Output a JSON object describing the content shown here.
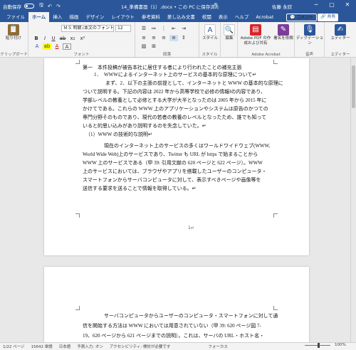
{
  "titlebar": {
    "autosave": "自動保存",
    "doc_title": "14_準備書面（1）.docx • この PC に保存済み",
    "search_label": "🔍",
    "user": "佐藤 永欣",
    "minimize": "─",
    "restore": "▢",
    "close": "✕"
  },
  "tabs": [
    "ファイル",
    "ホーム",
    "挿入",
    "描画",
    "デザイン",
    "レイアウト",
    "参考資料",
    "差し込み文書",
    "校閲",
    "表示",
    "ヘルプ",
    "Acrobat"
  ],
  "tabs_active_index": 1,
  "ribbon": {
    "comment_btn": "💬 コメント",
    "share_btn": "🔗 共有",
    "paste": "貼り付け",
    "clipboard": "クリップボード",
    "font_name": "ＭＳ 明朝 (本文のフォント - 日本語)",
    "font_size": "12",
    "font_group": "フォント",
    "paragraph_group": "段落",
    "style": "スタイル",
    "styles_group": "スタイル",
    "edit": "編集",
    "adobe_pdf": "Adobe PDF の作成および共有",
    "sign": "署名を依頼",
    "acrobat_group": "Adobe Acrobat",
    "dictate": "ディクテーション",
    "voice_group": "音声",
    "editor": "エディター",
    "editor_group": "エディター"
  },
  "document": {
    "page1_lines": [
      "第一　本件投稿が被告本社に居住する者により行われたことの補充主張",
      "1．　WWWによるインターネット上のサービスの基本的な原理について↵",
      "まず、2．以下の主張の前提として、インターネットと WWW の基本的な原理に",
      "ついて説明する。下記の内容は 2022 年から高等学校で必修の情報Ⅰの内容であり、",
      "学部レベルの教養として必修とする大学が大半となったのは 2005 年から 2015 年に",
      "かけてである。これらの WWW 上のアプリケーションやシステムは原告のかつての",
      "専門分野そのものであり、現代の若者の教養のレベルとなったため、誰でも知って",
      "いると的思い込みがあり説明するのを失念していた。↵",
      "（1）WWW の技術的な説明↵",
      "現在のインターネット上のサービスの多くはワールドワイドウェブ(WWW,",
      "World Wide Web)上のサービスであり、Twitter も URL が https で始まることから",
      "WWW 上のサービスである（甲 39: 引用文献の 620 ページと 622 ページ）。WWW",
      "上のサービスにおいては、ブラウザやアプリを搭載したユーザーのコンピュータ・",
      "スマートフォンからサーバコンピュータに対して、表示すべきページや画像等を",
      "送信する要求を送ることで情報を取得している。↵"
    ],
    "page_number": "1↵",
    "page2_lines": [
      "サーバコンピュータからユーザーのコンピュータ・スマートフォンに対して通",
      "信を開始する方法は WWW においては用意されていない（甲 39: 620 ページ図 7-",
      "19、620 ページから 621 ページまでの説明）。これは、サーバの URL・ホスト名・"
    ]
  },
  "status": {
    "page": "1/22 ページ",
    "words": "15642 単語",
    "lang": "日本語",
    "predict": "予測入力: オン",
    "access": "アクセシビリティ: 検討が必要です",
    "focus": "フォーカス",
    "zoom": "100%"
  }
}
